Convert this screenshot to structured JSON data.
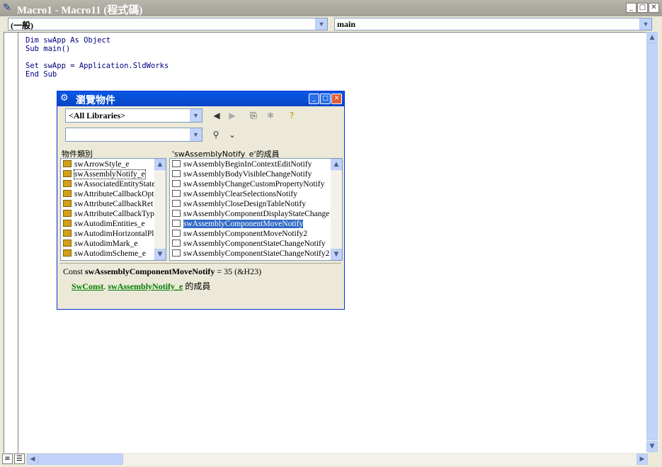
{
  "window": {
    "title": "Macro1 - Macro11 (程式碼)",
    "icon": "vba-module-icon",
    "buttons": [
      "minimize",
      "maximize",
      "close"
    ]
  },
  "object_combo": {
    "value": "(一般)"
  },
  "proc_combo": {
    "value": "main"
  },
  "code_lines": [
    "Dim swApp As Object",
    "Sub main()",
    "",
    "Set swApp = Application.SldWorks",
    "End Sub"
  ],
  "object_browser": {
    "title": "瀏覽物件",
    "library_combo": "<All Libraries>",
    "search_combo": "",
    "classes_header": "物件類別",
    "members_header": "'swAssemblyNotify_e'的成員",
    "classes": [
      "swArrowStyle_e",
      "swAssemblyNotify_e",
      "swAssociatedEntityState",
      "swAttributeCallbackOpt",
      "swAttributeCallbackRet",
      "swAttributeCallbackTyp",
      "swAutodimEntities_e",
      "swAutodimHorizontalPl",
      "swAutodimMark_e",
      "swAutodimScheme_e"
    ],
    "members": [
      "swAssemblyBeginInContextEditNotify",
      "swAssemblyBodyVisibleChangeNotify",
      "swAssemblyChangeCustomPropertyNotify",
      "swAssemblyClearSelectionsNotify",
      "swAssemblyCloseDesignTableNotify",
      "swAssemblyComponentDisplayStateChange",
      "swAssemblyComponentMoveNotify",
      "swAssemblyComponentMoveNotify2",
      "swAssemblyComponentStateChangeNotify",
      "swAssemblyComponentStateChangeNotify2"
    ],
    "selected_member": "swAssemblyComponentMoveNotify",
    "detail": {
      "prefix": "Const",
      "name": "swAssemblyComponentMoveNotify",
      "value": "= 35 (&H23)",
      "lib_link": "SwConst",
      "sep": ".",
      "class_link": "swAssemblyNotify_e",
      "suffix": "的成員"
    }
  },
  "colors": {
    "titlebar_inactive": "#a19e96",
    "ob_titlebar": "#0545c9",
    "selection": "#316ac5",
    "code_text": "#00007f",
    "link": "#007f00"
  }
}
